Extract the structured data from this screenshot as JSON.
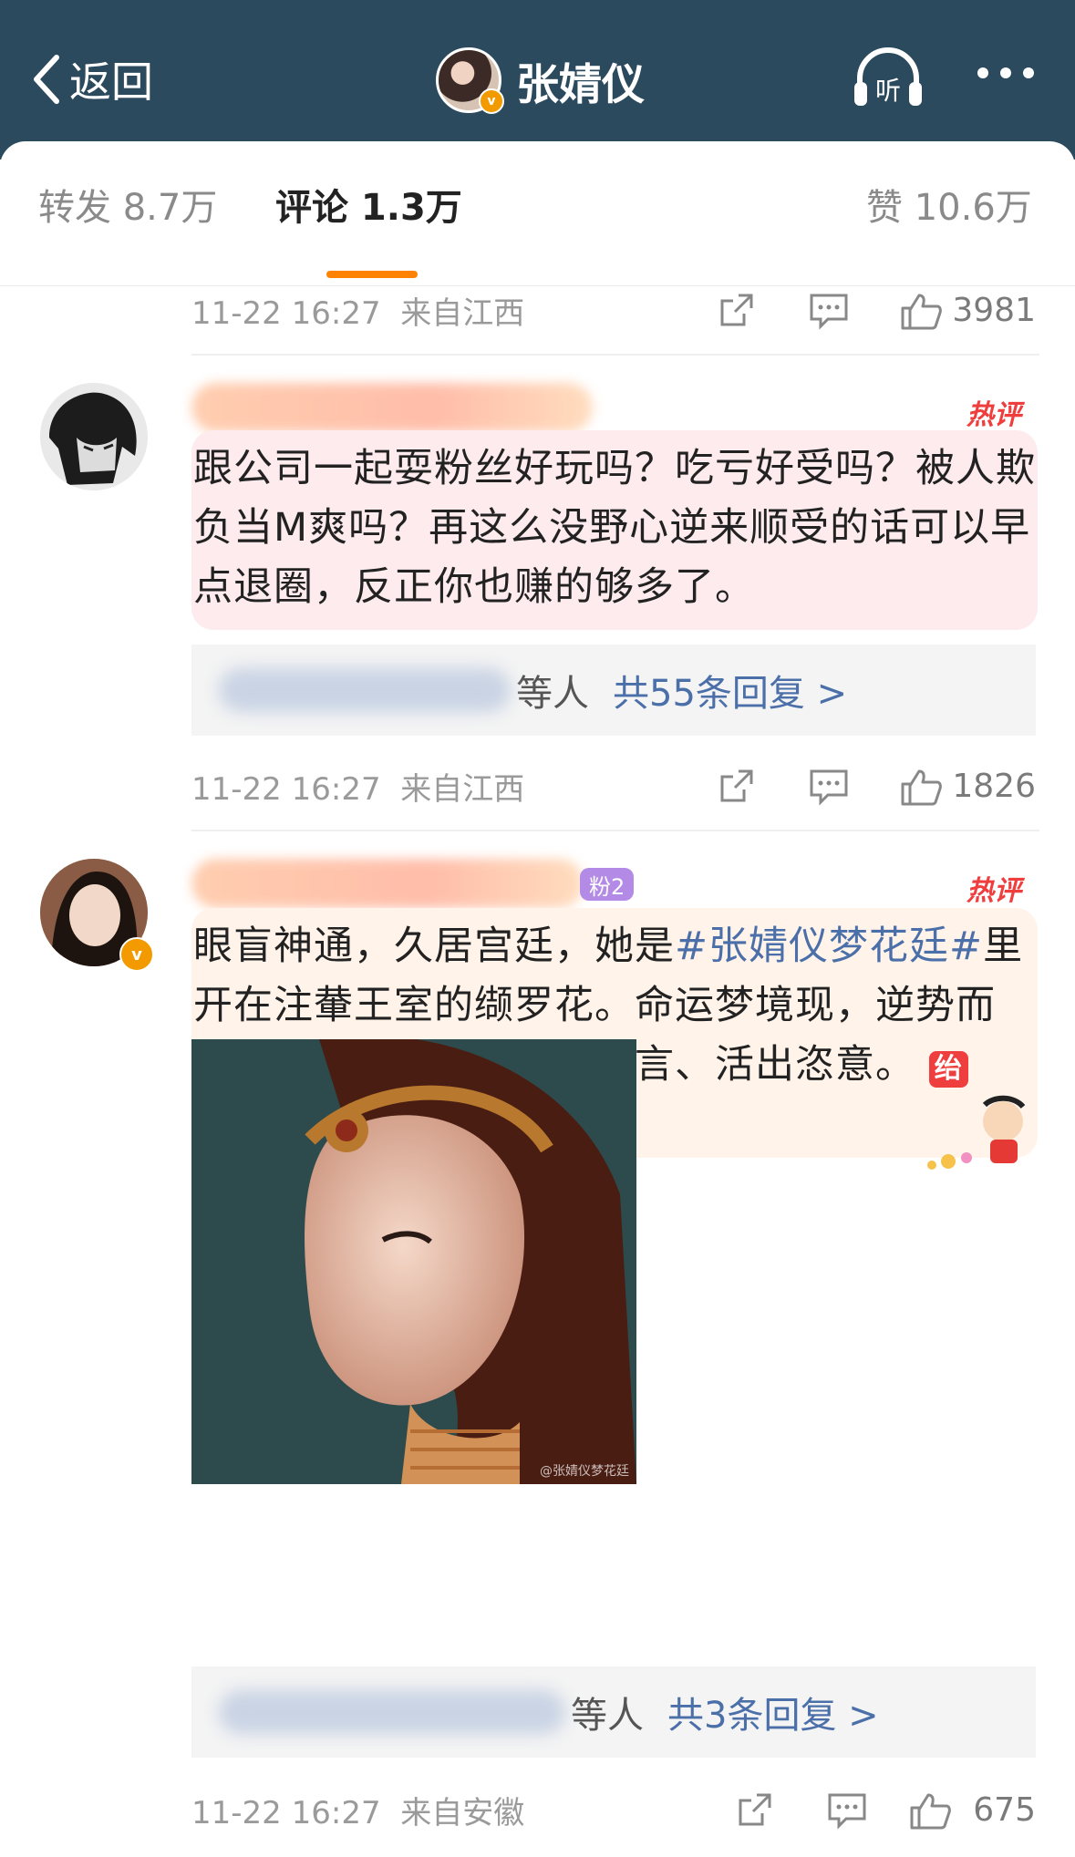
{
  "header": {
    "back_label": "返回",
    "user_name": "张婧仪",
    "verified_badge": "v",
    "listen_label": "听",
    "listen_icon": "headphones-icon",
    "more_icon": "more-dots-icon"
  },
  "tabs": [
    {
      "label": "转发 8.7万"
    },
    {
      "label": "评论 1.3万",
      "active": true
    },
    {
      "label": "赞 10.6万"
    }
  ],
  "accent_color": "#ff8200",
  "link_color": "#4b6fa8",
  "meta_rows": [
    {
      "time": "11-22 16:27",
      "source": "来自江西",
      "likes": "3981"
    },
    {
      "time": "11-22 16:27",
      "source": "来自江西",
      "likes": "1826"
    },
    {
      "time": "11-22 16:27",
      "source": "来自安徽",
      "likes": "675"
    }
  ],
  "comments": [
    {
      "hot_label": "热评",
      "text": "跟公司一起耍粉丝好玩吗？吃亏好受吗？被人欺负当M爽吗？再这么没野心逆来顺受的话可以早点退圈，反正你也赚的够多了。",
      "reply_suffix": "等人",
      "reply_link": "共55条回复 >"
    },
    {
      "hot_label": "热评",
      "fan_badge": "粉2",
      "text_before": "眼盲神通，久居宫廷，她是",
      "hashtag": "#张婧仪梦花廷#",
      "text_after": "里开在注輂王室的缬罗花。命运梦境现，逆势而起，看盲歌者缇兰改写预言、活出恣意。",
      "sticker": "绐",
      "image_watermark": "@张婧仪梦花廷",
      "reply_suffix": "等人",
      "reply_link": "共3条回复 >"
    }
  ]
}
